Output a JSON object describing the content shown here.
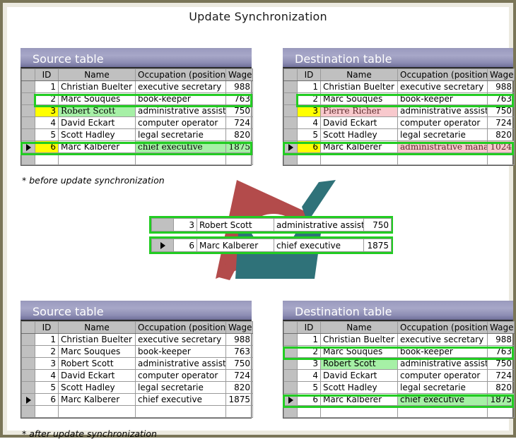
{
  "title": "Update Synchronization",
  "theme": {
    "frame_border": "#7a7557",
    "frame_inner": "#eceae0",
    "panel_title_bg": "#8d8db4",
    "highlight_outline": "#22cc22",
    "changed_cell_green": "#a6f0a6",
    "changed_cell_pink": "#f8c9cd",
    "key_cell_yellow": "#ffff00",
    "header_bg": "#c0c0c0"
  },
  "columns": [
    "ID",
    "Name",
    "Occupation (position)",
    "Wage"
  ],
  "captions": {
    "before": "* before update synchronization",
    "after": "* after update synchronization"
  },
  "panels": {
    "source_before": {
      "title": "Source table",
      "rows": [
        {
          "selector": "",
          "id": "1",
          "name": "Christian Buelter",
          "occupation": "executive secretary",
          "wage": "988"
        },
        {
          "selector": "",
          "id": "2",
          "name": "Marc Souques",
          "occupation": "book-keeper",
          "wage": "763"
        },
        {
          "selector": "",
          "id": "3",
          "name": "Robert Scott",
          "occupation": "administrative assistant",
          "wage": "750"
        },
        {
          "selector": "",
          "id": "4",
          "name": "David Eckart",
          "occupation": "computer operator",
          "wage": "724"
        },
        {
          "selector": "",
          "id": "5",
          "name": "Scott Hadley",
          "occupation": "legal secretarie",
          "wage": "820"
        },
        {
          "selector": "record-pointer",
          "id": "6",
          "name": "Marc Kalberer",
          "occupation": "chief executive",
          "wage": "1875"
        },
        {
          "selector": "",
          "id": "",
          "name": "",
          "occupation": "",
          "wage": ""
        }
      ]
    },
    "destination_before": {
      "title": "Destination table",
      "rows": [
        {
          "selector": "",
          "id": "1",
          "name": "Christian Buelter",
          "occupation": "executive secretary",
          "wage": "988"
        },
        {
          "selector": "",
          "id": "2",
          "name": "Marc Souques",
          "occupation": "book-keeper",
          "wage": "763"
        },
        {
          "selector": "",
          "id": "3",
          "name": "Pierre Richer",
          "occupation": "administrative assistant",
          "wage": "750"
        },
        {
          "selector": "",
          "id": "4",
          "name": "David Eckart",
          "occupation": "computer operator",
          "wage": "724"
        },
        {
          "selector": "",
          "id": "5",
          "name": "Scott Hadley",
          "occupation": "legal secretarie",
          "wage": "820"
        },
        {
          "selector": "record-pointer",
          "id": "6",
          "name": "Marc Kalberer",
          "occupation": "administrative manager",
          "wage": "1024"
        },
        {
          "selector": "",
          "id": "",
          "name": "",
          "occupation": "",
          "wage": ""
        }
      ]
    },
    "source_after": {
      "title": "Source table",
      "rows": [
        {
          "selector": "",
          "id": "1",
          "name": "Christian Buelter",
          "occupation": "executive secretary",
          "wage": "988"
        },
        {
          "selector": "",
          "id": "2",
          "name": "Marc Souques",
          "occupation": "book-keeper",
          "wage": "763"
        },
        {
          "selector": "",
          "id": "3",
          "name": "Robert Scott",
          "occupation": "administrative assistant",
          "wage": "750"
        },
        {
          "selector": "",
          "id": "4",
          "name": "David Eckart",
          "occupation": "computer operator",
          "wage": "724"
        },
        {
          "selector": "",
          "id": "5",
          "name": "Scott Hadley",
          "occupation": "legal secretarie",
          "wage": "820"
        },
        {
          "selector": "record-pointer",
          "id": "6",
          "name": "Marc Kalberer",
          "occupation": "chief executive",
          "wage": "1875"
        },
        {
          "selector": "",
          "id": "",
          "name": "",
          "occupation": "",
          "wage": ""
        }
      ]
    },
    "destination_after": {
      "title": "Destination table",
      "rows": [
        {
          "selector": "",
          "id": "1",
          "name": "Christian Buelter",
          "occupation": "executive secretary",
          "wage": "988"
        },
        {
          "selector": "",
          "id": "2",
          "name": "Marc Souques",
          "occupation": "book-keeper",
          "wage": "763"
        },
        {
          "selector": "",
          "id": "3",
          "name": "Robert Scott",
          "occupation": "administrative assistant",
          "wage": "750"
        },
        {
          "selector": "",
          "id": "4",
          "name": "David Eckart",
          "occupation": "computer operator",
          "wage": "724"
        },
        {
          "selector": "",
          "id": "5",
          "name": "Scott Hadley",
          "occupation": "legal secretarie",
          "wage": "820"
        },
        {
          "selector": "record-pointer",
          "id": "6",
          "name": "Marc Kalberer",
          "occupation": "chief executive",
          "wage": "1875"
        },
        {
          "selector": "",
          "id": "",
          "name": "",
          "occupation": "",
          "wage": ""
        }
      ]
    }
  },
  "transfer": {
    "rows": [
      {
        "selector": "",
        "id": "3",
        "name": "Robert Scott",
        "occupation": "administrative assistant",
        "wage": "750"
      },
      {
        "selector": "record-pointer",
        "id": "6",
        "name": "Marc Kalberer",
        "occupation": "chief executive",
        "wage": "1875"
      }
    ]
  }
}
